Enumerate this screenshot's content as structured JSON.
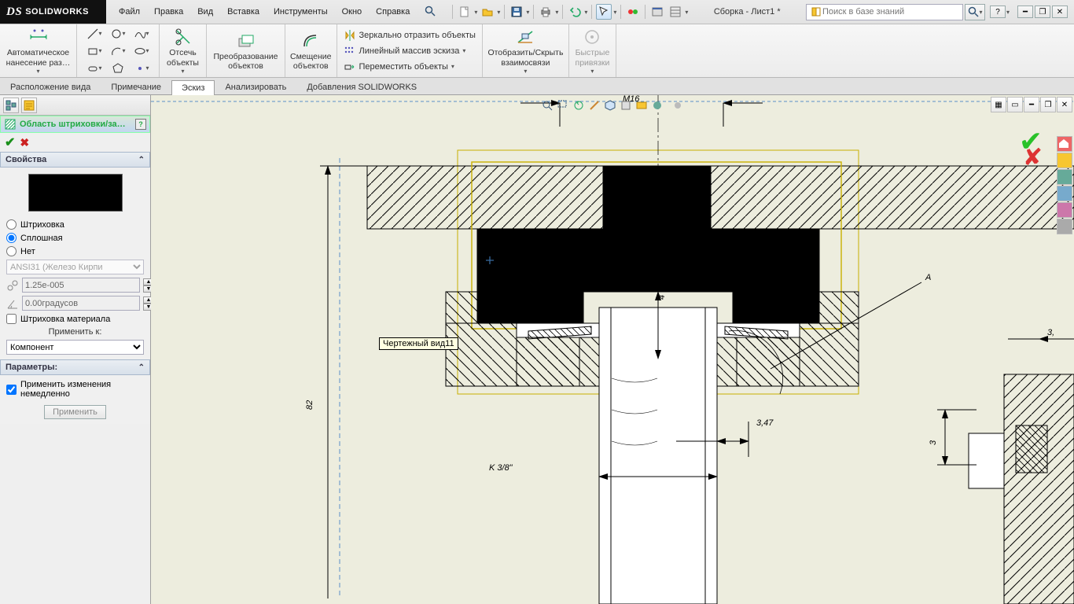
{
  "app": {
    "name": "SOLIDWORKS",
    "ds_glyph": "DS"
  },
  "menu": {
    "file": "Файл",
    "edit": "Правка",
    "view": "Вид",
    "insert": "Вставка",
    "tools": "Инструменты",
    "window": "Окно",
    "help": "Справка"
  },
  "doc_title": "Сборка - Лист1 *",
  "search": {
    "placeholder": "Поиск в базе знаний"
  },
  "ribbon": {
    "auto_dim": "Автоматическое\nнанесение раз…",
    "trim": "Отсечь\nобъекты",
    "convert": "Преобразование\nобъектов",
    "offset": "Смещение\nобъектов",
    "mirror": "Зеркально отразить объекты",
    "linear": "Линейный массив эскиза",
    "move": "Переместить объекты",
    "showhide": "Отобразить/Скрыть\nвзаимосвязи",
    "quick": "Быстрые\nпривязки"
  },
  "tabs": {
    "layout": "Расположение вида",
    "annotation": "Примечание",
    "sketch": "Эскиз",
    "analyze": "Анализировать",
    "addins": "Добавления SOLIDWORKS"
  },
  "pm": {
    "title": "Область штриховки/за…",
    "properties": "Свойства",
    "r_hatch": "Штриховка",
    "r_solid": "Сплошная",
    "r_none": "Нет",
    "pattern_sel": "ANSI31 (Железо Кирпи",
    "scale": "1.25e-005",
    "angle": "0.00градусов",
    "material_hatch": "Штриховка материала",
    "apply_to": "Применить к:",
    "apply_to_sel": "Компонент",
    "params": "Параметры:",
    "apply_imm": "Применить изменения немедленно",
    "apply_btn": "Применить"
  },
  "drawing": {
    "tooltip": "Чертежный вид11",
    "dims": {
      "top": "M16",
      "gap": "4",
      "left_v": "82",
      "thread": "K 3/8\"",
      "r1": "3,47",
      "A": "A",
      "r2": "3,",
      "r3": "3"
    }
  }
}
